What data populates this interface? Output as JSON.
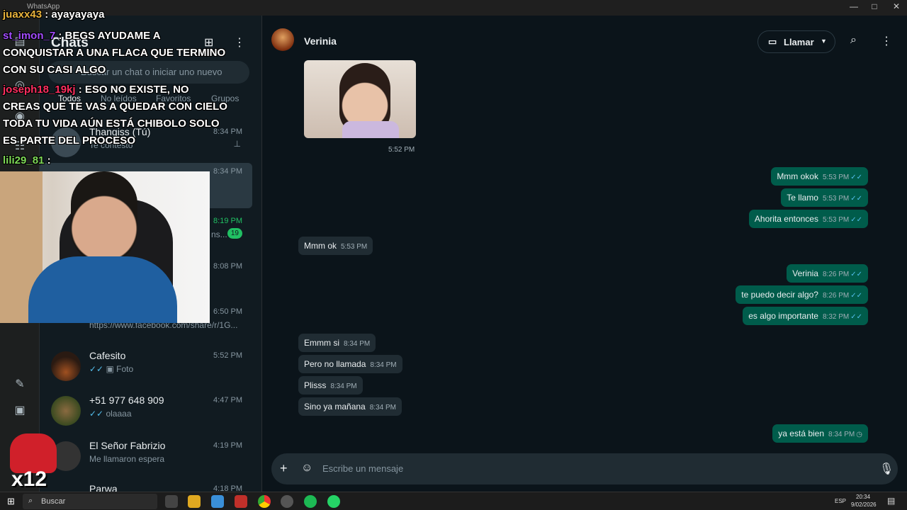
{
  "window": {
    "app_name": "WhatsApp",
    "minimize": "—",
    "maximize": "□",
    "close": "✕"
  },
  "sidebar_header": {
    "title": "Chats",
    "search_placeholder": "Buscar un chat o iniciar uno nuevo",
    "filters": [
      "Todos",
      "No leídos",
      "Favoritos",
      "Grupos"
    ]
  },
  "chats": [
    {
      "name": "Thangiss (Tú)",
      "time": "8:34 PM",
      "preview": "Te contesto",
      "pinned": true
    },
    {
      "name": "",
      "time": "8:34 PM",
      "preview": ""
    },
    {
      "name": "",
      "time": "8:19 PM",
      "preview": "ns...",
      "unread": "19"
    },
    {
      "name": "",
      "time": "8:08 PM",
      "preview": ""
    },
    {
      "name": "",
      "time": "6:50 PM",
      "preview": "https://www.facebook.com/share/r/1G..."
    },
    {
      "name": "Cafesito",
      "time": "5:52 PM",
      "preview": "Foto"
    },
    {
      "name": "+51 977 648 909",
      "time": "4:47 PM",
      "preview": "olaaaa"
    },
    {
      "name": "El Señor Fabrizio",
      "time": "4:19 PM",
      "preview": "Me llamaron espera"
    },
    {
      "name": "Parwa",
      "time": "4:18 PM",
      "preview": ""
    }
  ],
  "conversation": {
    "contact_name": "Verinia",
    "call_label": "Llamar",
    "photo_time": "5:52 PM",
    "composer_placeholder": "Escribe un mensaje"
  },
  "messages": [
    {
      "text": "Mmm okok",
      "time": "5:53 PM",
      "dir": "out"
    },
    {
      "text": "Te llamo",
      "time": "5:53 PM",
      "dir": "out"
    },
    {
      "text": "Ahorita entonces",
      "time": "5:53 PM",
      "dir": "out"
    },
    {
      "text": "Mmm ok",
      "time": "5:53 PM",
      "dir": "in"
    },
    {
      "text": "Verinia",
      "time": "8:26 PM",
      "dir": "out"
    },
    {
      "text": "te puedo decir algo?",
      "time": "8:26 PM",
      "dir": "out"
    },
    {
      "text": "es algo importante",
      "time": "8:32 PM",
      "dir": "out"
    },
    {
      "text": "Emmm si",
      "time": "8:34 PM",
      "dir": "in"
    },
    {
      "text": "Pero no llamada",
      "time": "8:34 PM",
      "dir": "in"
    },
    {
      "text": "Plisss",
      "time": "8:34 PM",
      "dir": "in"
    },
    {
      "text": "Sino ya mañana",
      "time": "8:34 PM",
      "dir": "in"
    },
    {
      "text": "ya está bien",
      "time": "8:34 PM",
      "dir": "out"
    }
  ],
  "stream_chat": [
    {
      "user": "juaxx43",
      "text": ": ayayayaya"
    },
    {
      "user": "st_imon_7",
      "text": ": BEGS AYUDAME A"
    },
    {
      "user": "",
      "text": "CONQUISTAR A UNA FLACA QUE TERMINO"
    },
    {
      "user": "",
      "text": "CON SU CASI ALGO"
    },
    {
      "user": "joseph18_19kj",
      "text": ": ESO NO EXISTE, NO"
    },
    {
      "user": "",
      "text": "CREAS QUE TE VAS A QUEDAR CON CIELO"
    },
    {
      "user": "",
      "text": "TODA TU VIDA AÚN ESTÁ CHIBOLO SOLO"
    },
    {
      "user": "",
      "text": "ES PARTE DEL PROCESO"
    },
    {
      "user": "lili29_81",
      "text": ":"
    }
  ],
  "overlay_badge": "x12",
  "taskbar": {
    "search": "Buscar",
    "lang": "ESP",
    "time": "20:34",
    "date": "9/02/2026"
  },
  "colors": {
    "outgoing": "#005c4b",
    "incoming": "#202c33",
    "accent": "#21c063"
  }
}
